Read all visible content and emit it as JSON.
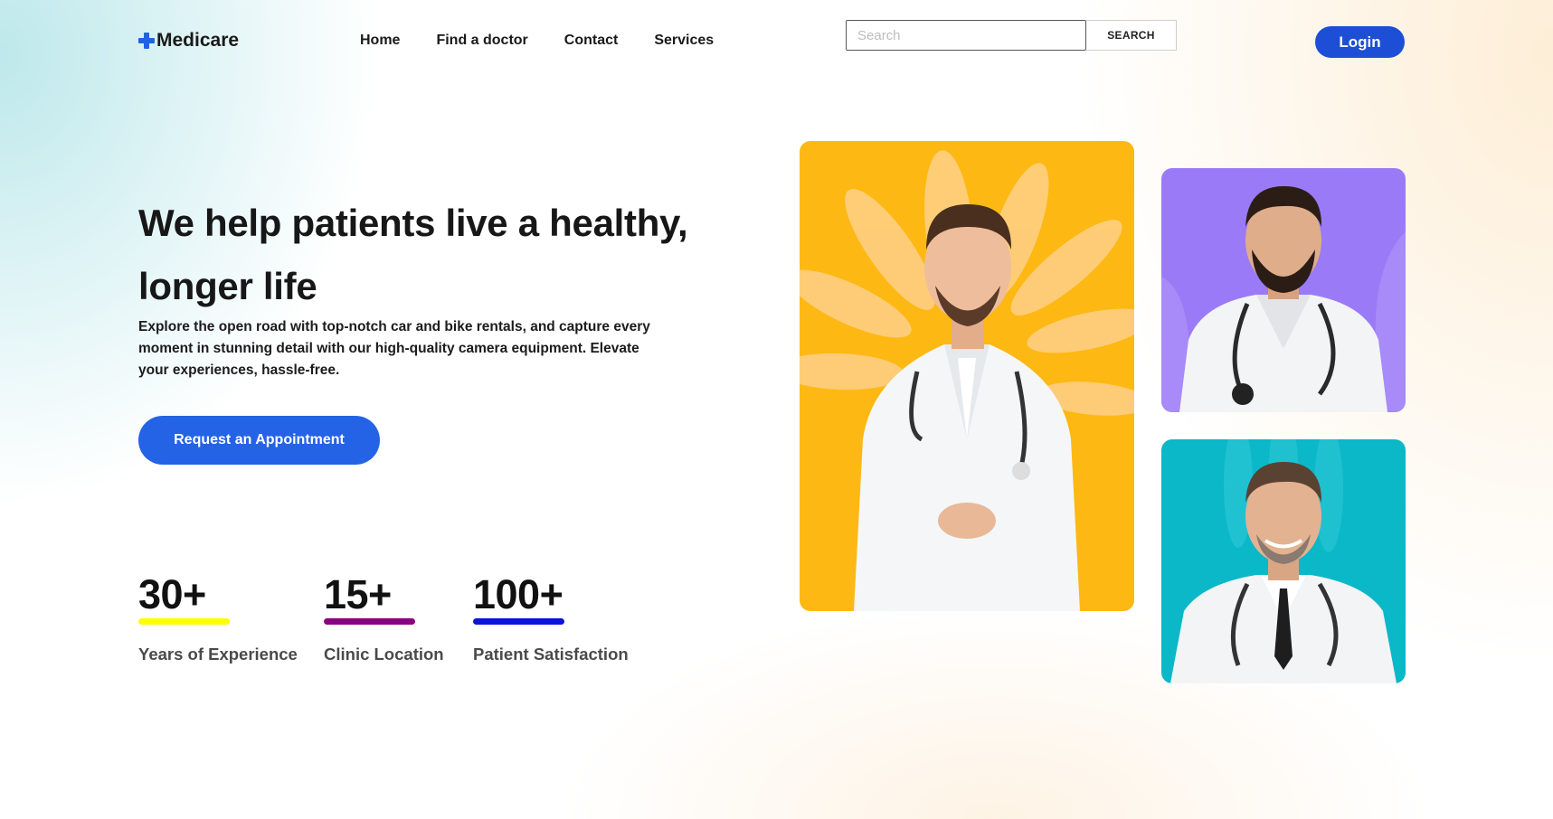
{
  "header": {
    "brand": "Medicare",
    "brand_icon": "plus-icon",
    "nav": [
      {
        "label": "Home"
      },
      {
        "label": "Find a doctor"
      },
      {
        "label": "Contact"
      },
      {
        "label": "Services"
      }
    ],
    "search": {
      "placeholder": "Search",
      "value": "",
      "button_label": "SEARCH"
    },
    "login_label": "Login"
  },
  "hero": {
    "title": "We help patients live a healthy, longer life",
    "description": "Explore the open road with top-notch car and bike rentals, and capture every moment in stunning detail with our high-quality camera equipment. Elevate your experiences, hassle-free.",
    "cta_label": "Request an Appointment"
  },
  "stats": [
    {
      "value": "30+",
      "label": "Years of Experience",
      "underline_color": "#ffff00"
    },
    {
      "value": "15+",
      "label": "Clinic Location",
      "underline_color": "#8b007f"
    },
    {
      "value": "100+",
      "label": "Patient Satisfaction",
      "underline_color": "#0a14d6"
    }
  ],
  "images": [
    {
      "name": "doctor-photo-main",
      "background": "#fdb813"
    },
    {
      "name": "doctor-photo-top",
      "background": "#9b7af7"
    },
    {
      "name": "doctor-photo-bottom",
      "background": "#0ab8c8"
    }
  ],
  "colors": {
    "primary": "#1d4fd6",
    "cta": "#2463e6"
  }
}
